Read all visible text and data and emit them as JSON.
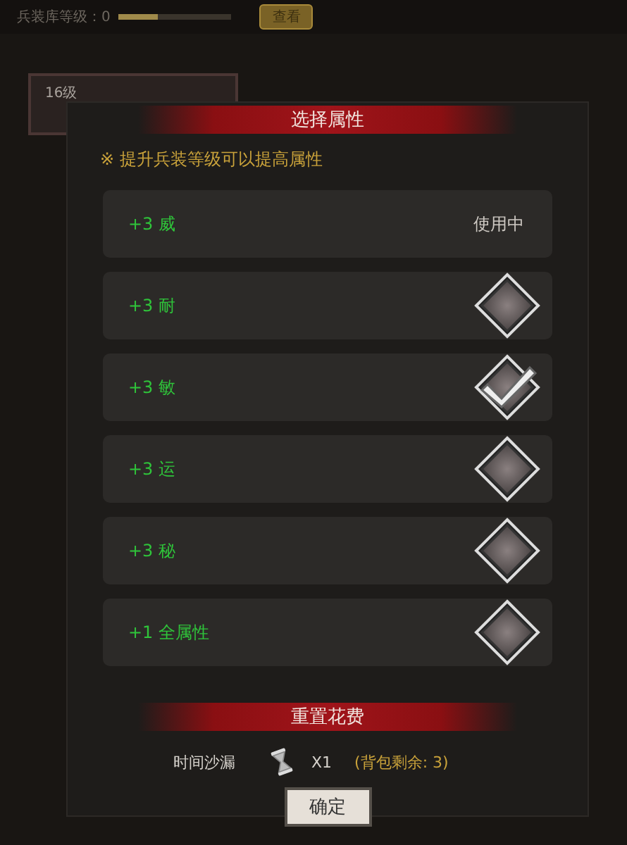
{
  "top_bar": {
    "level_label": "兵装库等级：0",
    "level": 0.35,
    "view_button": "查看"
  },
  "card": {
    "level_tag": "16级"
  },
  "dialog": {
    "title": "选择属性",
    "note": "※ 提升兵装等级可以提高属性",
    "options": [
      {
        "label": "+3 威",
        "kind": "status",
        "status": "使用中"
      },
      {
        "label": "+3 耐",
        "kind": "choice",
        "selected": false
      },
      {
        "label": "+3 敏",
        "kind": "choice",
        "selected": true
      },
      {
        "label": "+3 运",
        "kind": "choice",
        "selected": false
      },
      {
        "label": "+3 秘",
        "kind": "choice",
        "selected": false
      },
      {
        "label": "+1 全属性",
        "kind": "choice",
        "selected": false
      }
    ],
    "cost_title": "重置花费",
    "cost": {
      "item": "时间沙漏",
      "quantity": "X1",
      "remaining": "(背包剩余: 3)"
    },
    "confirm": "确定"
  }
}
